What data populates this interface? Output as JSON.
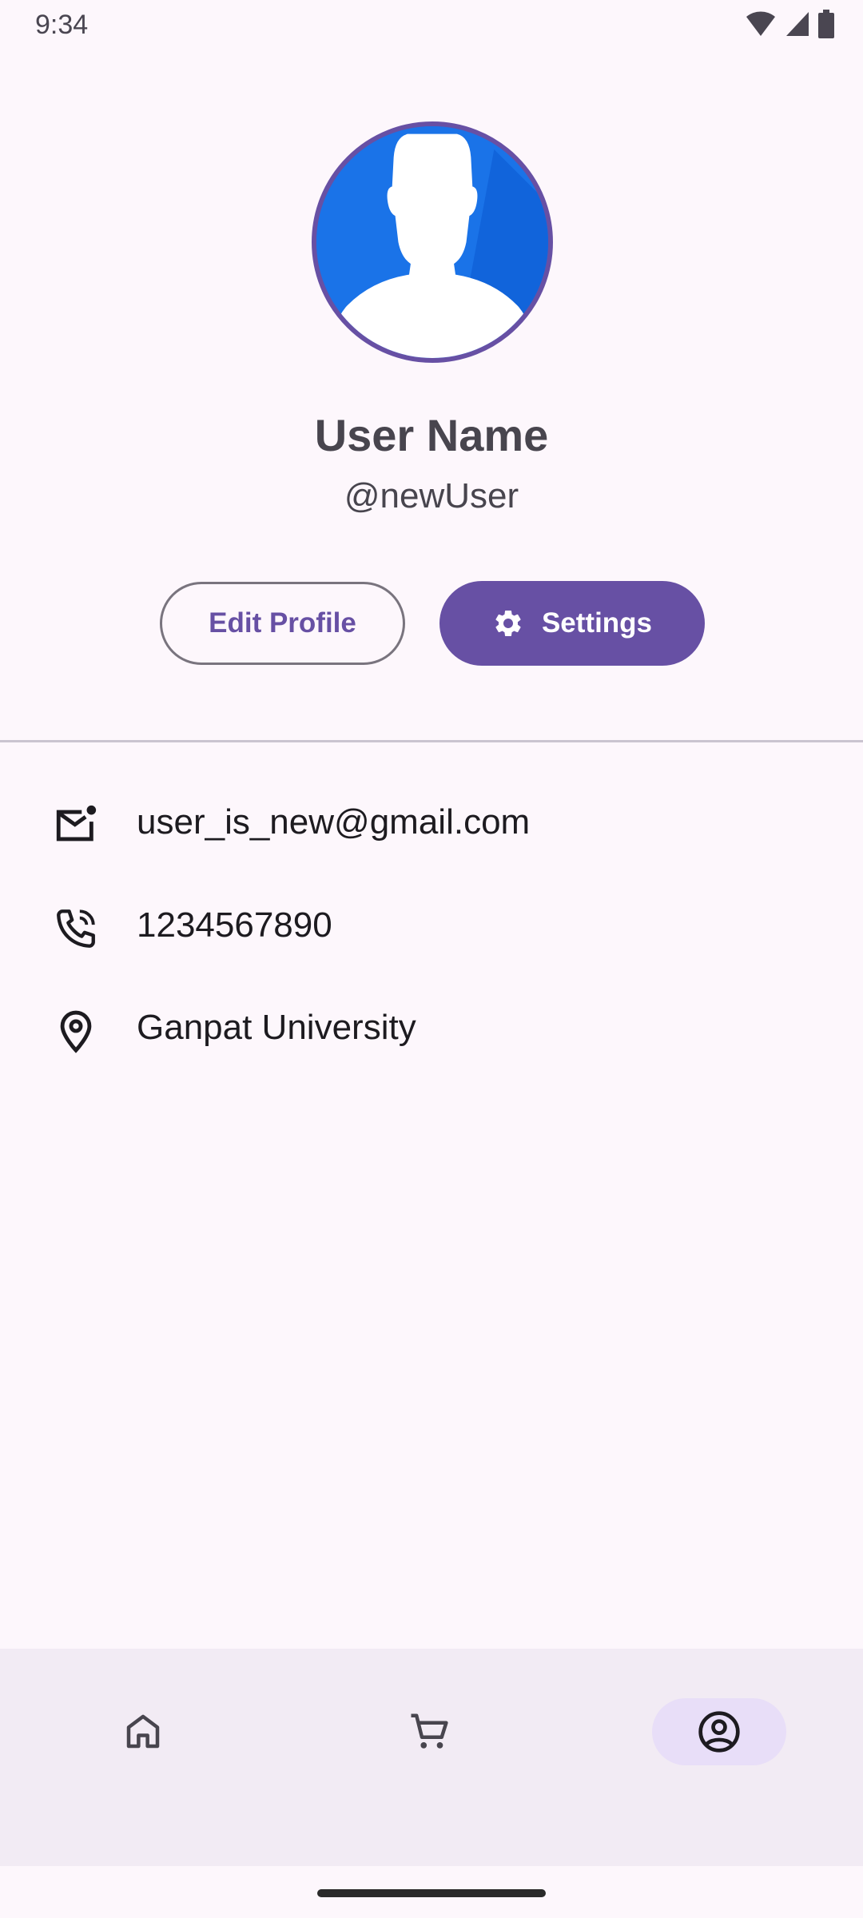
{
  "status_bar": {
    "time": "9:34",
    "icons": [
      "wifi-icon",
      "cell-signal-icon",
      "battery-icon"
    ]
  },
  "profile": {
    "avatar_icon": "person-silhouette-icon",
    "name": "User Name",
    "handle": "@newUser"
  },
  "actions": {
    "edit_label": "Edit Profile",
    "settings_label": "Settings",
    "settings_icon": "gear-icon"
  },
  "info": {
    "email": "user_is_new@gmail.com",
    "phone": "1234567890",
    "location": "Ganpat University",
    "email_icon": "mail-unread-icon",
    "phone_icon": "phone-call-icon",
    "location_icon": "location-pin-icon"
  },
  "bottom_nav": {
    "items": [
      {
        "icon": "home-icon",
        "active": false
      },
      {
        "icon": "cart-icon",
        "active": false
      },
      {
        "icon": "account-circle-icon",
        "active": true
      }
    ]
  },
  "colors": {
    "primary": "#6750A4",
    "background": "#FDF7FC",
    "nav_background": "#F2EBF4",
    "nav_active_pill": "#E8DEF8",
    "text": "#1D1B20",
    "avatar_blue": "#1A73E8"
  }
}
